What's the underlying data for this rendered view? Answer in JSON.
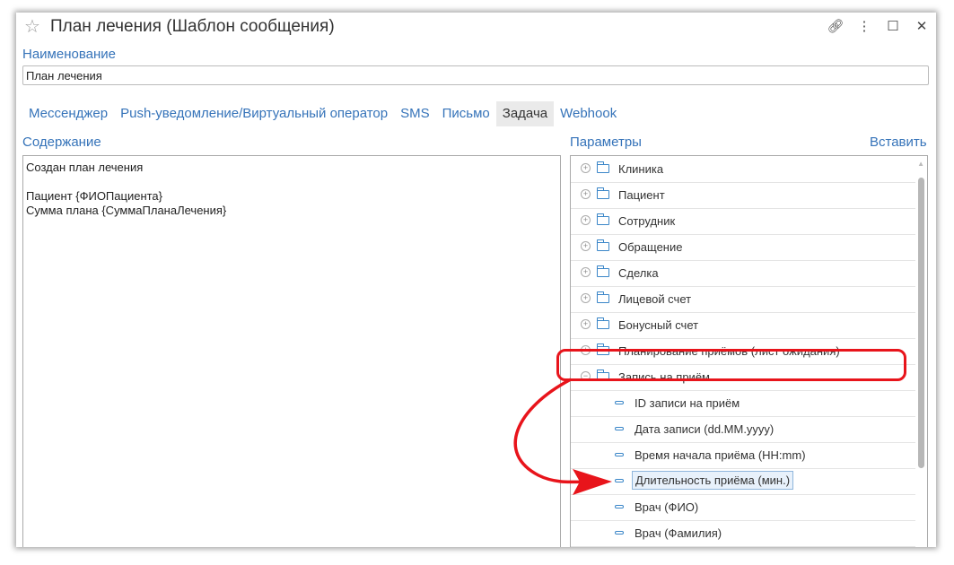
{
  "window": {
    "title": "План лечения (Шаблон сообщения)"
  },
  "name_field": {
    "label": "Наименование",
    "value": "План лечения"
  },
  "tabs": [
    {
      "label": "Мессенджер",
      "active": false
    },
    {
      "label": "Push-уведомление/Виртуальный оператор",
      "active": false
    },
    {
      "label": "SMS",
      "active": false
    },
    {
      "label": "Письмо",
      "active": false
    },
    {
      "label": "Задача",
      "active": true
    },
    {
      "label": "Webhook",
      "active": false
    }
  ],
  "content": {
    "label": "Содержание",
    "lines": [
      "Создан план лечения",
      "",
      "Пациент  {ФИОПациента}",
      "Сумма плана  {СуммаПланаЛечения}"
    ]
  },
  "params": {
    "label": "Параметры",
    "insert_label": "Вставить",
    "groups": [
      {
        "label": "Клиника",
        "expanded": false
      },
      {
        "label": "Пациент",
        "expanded": false
      },
      {
        "label": "Сотрудник",
        "expanded": false
      },
      {
        "label": "Обращение",
        "expanded": false
      },
      {
        "label": "Сделка",
        "expanded": false
      },
      {
        "label": "Лицевой счет",
        "expanded": false
      },
      {
        "label": "Бонусный счет",
        "expanded": false
      },
      {
        "label": "Планирование приёмов (лист ожидания)",
        "expanded": false
      },
      {
        "label": "Запись на приём",
        "expanded": true
      }
    ],
    "attributes": [
      {
        "label": "ID записи на приём",
        "selected": false
      },
      {
        "label": "Дата записи (dd.MM.yyyy)",
        "selected": false
      },
      {
        "label": "Время начала приёма (HH:mm)",
        "selected": false
      },
      {
        "label": "Длительность приёма (мин.)",
        "selected": true
      },
      {
        "label": "Врач (ФИО)",
        "selected": false
      },
      {
        "label": "Врач (Фамилия)",
        "selected": false
      }
    ]
  },
  "colors": {
    "accent": "#3573b9",
    "annotation": "#e8141b"
  }
}
